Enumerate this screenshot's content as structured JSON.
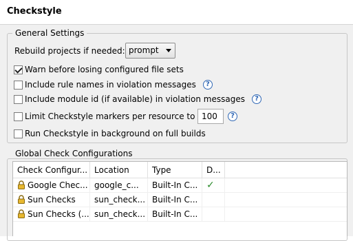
{
  "page": {
    "title": "Checkstyle"
  },
  "general": {
    "legend": "General Settings",
    "rebuild_label": "Rebuild projects if needed:",
    "rebuild_value": "prompt",
    "warn_label": "Warn before losing configured file sets",
    "warn_checked": true,
    "rule_names_label": "Include rule names in violation messages",
    "rule_names_checked": false,
    "module_id_label": "Include module id (if available) in violation messages",
    "module_id_checked": false,
    "limit_label": "Limit Checkstyle markers per resource to",
    "limit_checked": false,
    "limit_value": "100",
    "background_label": "Run Checkstyle in background on full builds",
    "background_checked": false,
    "help_glyph": "?"
  },
  "global": {
    "legend": "Global Check Configurations",
    "columns": [
      "Check Configur...",
      "Location",
      "Type",
      "D..."
    ],
    "rows": [
      {
        "name": "Google Chec...",
        "location": "google_c...",
        "type": "Built-In C...",
        "default": "✓"
      },
      {
        "name": "Sun Checks",
        "location": "sun_check...",
        "type": "Built-In C...",
        "default": ""
      },
      {
        "name": "Sun Checks (...",
        "location": "sun_check...",
        "type": "Built-In C...",
        "default": ""
      }
    ]
  },
  "colors": {
    "check_green": "#2a8a2a",
    "help_blue": "#2f67b5"
  }
}
